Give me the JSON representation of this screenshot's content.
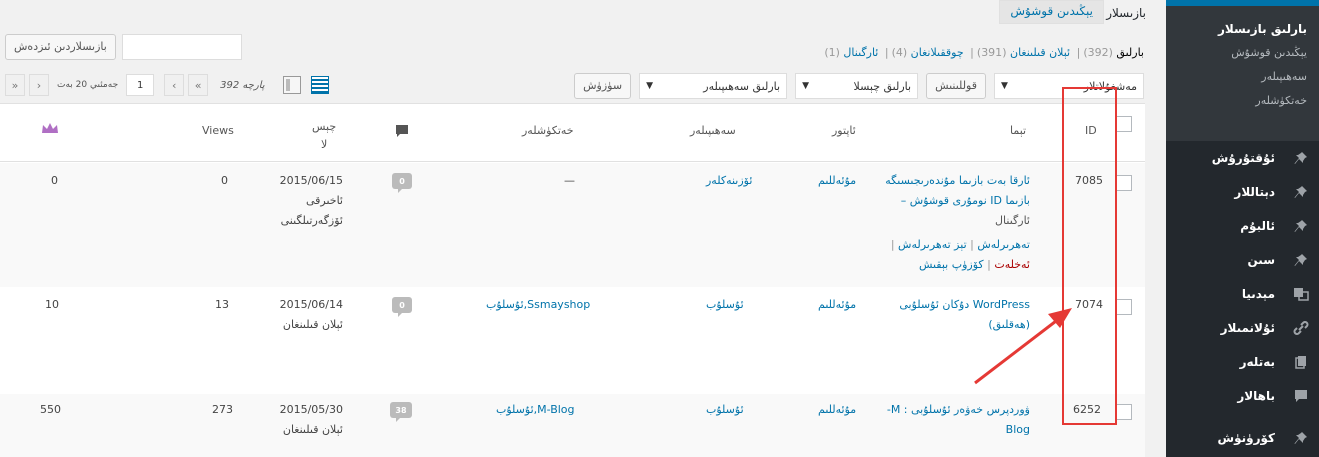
{
  "sidebar": {
    "header": "بارلىق بازىسلار",
    "sub_items": [
      "يېڭىدىن قوشۇش",
      "سەھىپىلەر",
      "خەتكۈشلەر"
    ],
    "items": [
      {
        "label": "ئۇقتۇرۇش",
        "icon": "pin-icon"
      },
      {
        "label": "دېتاللار",
        "icon": "pin-icon"
      },
      {
        "label": "ئالبۇم",
        "icon": "pin-icon"
      },
      {
        "label": "سىن",
        "icon": "pin-icon"
      },
      {
        "label": "مېدىيا",
        "icon": "media-icon"
      },
      {
        "label": "ئۇلانمىلار",
        "icon": "link-icon"
      },
      {
        "label": "بەتلەر",
        "icon": "pages-icon"
      },
      {
        "label": "باھالار",
        "icon": "comment-icon"
      },
      {
        "label": "كۆرۈنۈش",
        "icon": "appearance-icon"
      }
    ]
  },
  "header": {
    "title": "بازىسلار",
    "add_new": "يېڭىدىن قوشۇش"
  },
  "search": {
    "button": "بازىسلاردىن ئىزدەش",
    "placeholder": ""
  },
  "status_links": {
    "all": "بارلىق",
    "all_count": "(392)",
    "published": "ئېلان قىلىنغان",
    "published_count": "(391)",
    "drafts": "چوققىلانغان",
    "drafts_count": "(4)",
    "trash": "ئارگىنال",
    "trash_count": "(1)"
  },
  "tablenav": {
    "bulk_actions": "مەشغۇلاتلار",
    "apply": "قوللىنىش",
    "dates": "بارلىق چېسلا",
    "categories": "بارلىق سەھىپىلەر",
    "filter": "سۈزۈش",
    "items_count": "392 پارچە",
    "current_page": "1",
    "total_pages": "جەمئىي 20 بەت",
    "first": "«",
    "prev": "‹",
    "next": "›",
    "last": "»"
  },
  "columns": {
    "id": "ID",
    "title": "تېما",
    "author": "ئاپتور",
    "categories": "سەھىپىلەر",
    "tags": "خەتكۈشلەر",
    "date_line1": "چېس",
    "date_line2": "لا",
    "views": "Views"
  },
  "rows": [
    {
      "id": "7085",
      "title_line1": "ئارقا بەت بازىما مۇندەرىجىسىگە",
      "title_line2": "بازىما ID نومۇرى قوشۇش –",
      "title_state": "ئارگىنال",
      "action_edit": "تەھرىرلەش",
      "action_quick": "تېز تەھرىرلەش",
      "action_trash": "ئەخلەت",
      "action_preview": "كۆزۈپ بېقىش",
      "author": "مۇئەللىم",
      "category": "ئۆزىنەكلەر",
      "tags": "—",
      "comments": "0",
      "date": "2015/06/15",
      "status_line1": "ئاخىرقى",
      "status_line2": "ئۆزگەرتىلگىنى",
      "views": "0",
      "extra": "0"
    },
    {
      "id": "7074",
      "title_line1": "WordPress دۇكان ئۇسلۇبى",
      "title_line2": "(ھەقلىق)",
      "author": "مۇئەللىم",
      "category": "ئۇسلۇب",
      "tags": "ئۇسلۇب,Ssmayshop",
      "comments": "0",
      "date": "2015/06/14",
      "status_line1": "ئېلان قىلىنغان",
      "views": "13",
      "extra": "10"
    },
    {
      "id": "6252",
      "title_line1": "ۋوردپرس خەۋەر ئۇسلۇبى : M- ",
      "title_line2": "Blog",
      "author": "مۇئەللىم",
      "category": "ئۇسلۇب",
      "tags": "ئۇسلۇب,M-Blog",
      "comments": "38",
      "date": "2015/05/30",
      "status_line1": "ئېلان قىلىنغان",
      "views": "273",
      "extra": "550"
    }
  ],
  "colors": {
    "accent": "#0073aa",
    "sidebar_bg": "#23282d",
    "annotation": "#e53935"
  }
}
